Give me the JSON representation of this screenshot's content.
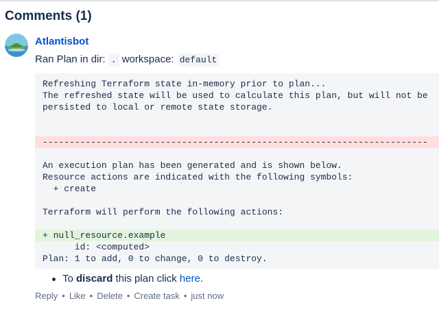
{
  "comments": {
    "heading": "Comments (1)"
  },
  "comment": {
    "author": "Atlantisbot",
    "intro": {
      "prefix": "Ran Plan in dir: ",
      "dir": ".",
      "mid": " workspace: ",
      "workspace": "default"
    },
    "code_lines": [
      "Refreshing Terraform state in-memory prior to plan...",
      "The refreshed state will be used to calculate this plan, but will not be",
      "persisted to local or remote state storage.",
      "",
      "",
      "------------------------------------------------------------------------",
      "",
      "An execution plan has been generated and is shown below.",
      "Resource actions are indicated with the following symbols:",
      "  + create",
      "",
      "Terraform will perform the following actions:",
      "",
      "+ null_resource.example",
      "      id: <computed>",
      "Plan: 1 to add, 0 to change, 0 to destroy."
    ],
    "discard": {
      "before": "To ",
      "bold": "discard",
      "middle": " this plan click ",
      "link": "here",
      "after": "."
    },
    "actions": {
      "reply": "Reply",
      "like": "Like",
      "delete": "Delete",
      "create_task": "Create task",
      "timestamp": "just now",
      "separator": "•"
    }
  },
  "colors": {
    "link": "#0052cc",
    "code_bg": "#f4f5f7",
    "removed_bg": "#ffdede",
    "added_bg": "#e1f5dd"
  }
}
